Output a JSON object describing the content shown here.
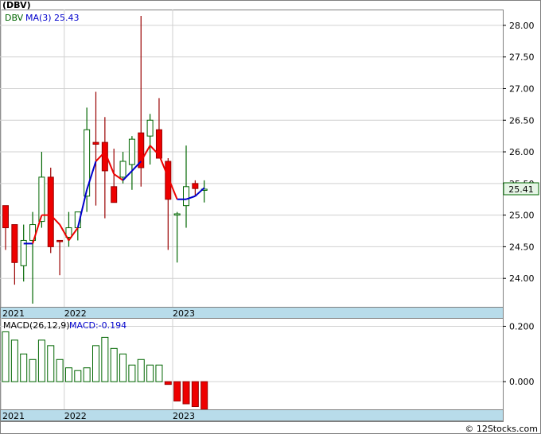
{
  "header": {
    "ticker_label": "(DBV)",
    "legend_symbol": "DBV",
    "legend_ma_label": "MA(3)",
    "legend_ma_value": "25.43",
    "last_price_tag": "25.41"
  },
  "macd_panel": {
    "label": "MACD(26,12,9)",
    "value_label": "MACD:-0.194",
    "ticks": [
      {
        "value": 0.2,
        "label": "0.200"
      },
      {
        "value": 0.0,
        "label": "0.000"
      }
    ],
    "ylim": [
      -0.1,
      0.23
    ]
  },
  "time_axis": {
    "year_labels": [
      {
        "label": "2021",
        "month_index": 0
      },
      {
        "label": "2022",
        "month_index": 7
      },
      {
        "label": "2023",
        "month_index": 19
      }
    ]
  },
  "footer": {
    "watermark": "© 12Stocks.com"
  },
  "colors": {
    "up_candle_fill": "#ffffff",
    "up_candle_stroke": "#006600",
    "down_candle_fill": "#ee0000",
    "wick_up": "#006600",
    "wick_down": "#990000",
    "ma_line_red": "#ee0000",
    "ma_line_blue": "#0000cc",
    "axis_band": "#b8dcea",
    "grid": "#d0d0d0",
    "macd_pos_stroke": "#006600",
    "macd_neg_fill": "#ee0000",
    "price_tag_bg": "#e6f5e6"
  },
  "chart_data": [
    {
      "type": "candlestick",
      "title": "(DBV)",
      "ylim": [
        23.55,
        28.25
      ],
      "yticks": [
        24.0,
        24.5,
        25.0,
        25.5,
        26.0,
        26.5,
        27.0,
        27.5,
        28.0
      ],
      "series": [
        {
          "name": "DBV",
          "values": [
            {
              "o": 25.15,
              "h": 25.15,
              "l": 24.45,
              "c": 24.8
            },
            {
              "o": 24.85,
              "h": 24.85,
              "l": 23.9,
              "c": 24.25
            },
            {
              "o": 24.2,
              "h": 24.85,
              "l": 23.95,
              "c": 24.6
            },
            {
              "o": 24.6,
              "h": 25.05,
              "l": 23.6,
              "c": 24.85
            },
            {
              "o": 24.9,
              "h": 26.0,
              "l": 24.8,
              "c": 25.6
            },
            {
              "o": 25.6,
              "h": 25.75,
              "l": 24.4,
              "c": 24.5
            },
            {
              "o": 24.6,
              "h": 24.6,
              "l": 24.05,
              "c": 24.58
            },
            {
              "o": 24.65,
              "h": 25.05,
              "l": 24.5,
              "c": 24.8
            },
            {
              "o": 24.8,
              "h": 25.05,
              "l": 24.6,
              "c": 25.05
            },
            {
              "o": 25.3,
              "h": 26.7,
              "l": 25.05,
              "c": 26.35
            },
            {
              "o": 26.15,
              "h": 26.95,
              "l": 25.15,
              "c": 26.12
            },
            {
              "o": 26.15,
              "h": 26.55,
              "l": 24.95,
              "c": 25.7
            },
            {
              "o": 25.45,
              "h": 26.05,
              "l": 25.4,
              "c": 25.2
            },
            {
              "o": 25.6,
              "h": 26.0,
              "l": 25.5,
              "c": 25.85
            },
            {
              "o": 25.8,
              "h": 26.25,
              "l": 25.4,
              "c": 26.2
            },
            {
              "o": 26.3,
              "h": 28.15,
              "l": 25.45,
              "c": 25.75
            },
            {
              "o": 26.25,
              "h": 26.6,
              "l": 25.8,
              "c": 26.5
            },
            {
              "o": 26.35,
              "h": 26.85,
              "l": 25.95,
              "c": 25.9
            },
            {
              "o": 25.85,
              "h": 25.9,
              "l": 24.45,
              "c": 25.25
            },
            {
              "o": 25.0,
              "h": 25.05,
              "l": 24.25,
              "c": 25.02
            },
            {
              "o": 25.15,
              "h": 26.1,
              "l": 24.8,
              "c": 25.45
            },
            {
              "o": 25.5,
              "h": 25.55,
              "l": 25.3,
              "c": 25.42
            },
            {
              "o": 25.41,
              "h": 25.55,
              "l": 25.2,
              "c": 25.41
            }
          ]
        },
        {
          "name": "MA(3)",
          "values": [
            null,
            null,
            24.55,
            24.55,
            25.0,
            25.0,
            24.85,
            24.6,
            24.8,
            25.4,
            25.85,
            26.0,
            25.65,
            25.55,
            25.7,
            25.85,
            26.1,
            25.95,
            25.6,
            25.25,
            25.25,
            25.3,
            25.43
          ]
        }
      ]
    },
    {
      "type": "bar",
      "title": "MACD(26,12,9)",
      "ylim": [
        -0.1,
        0.23
      ],
      "yticks": [
        0.2,
        0.0
      ],
      "series": [
        {
          "name": "MACD",
          "values": [
            0.18,
            0.15,
            0.1,
            0.08,
            0.15,
            0.13,
            0.08,
            0.05,
            0.04,
            0.05,
            0.13,
            0.16,
            0.12,
            0.1,
            0.06,
            0.08,
            0.06,
            0.06,
            -0.01,
            -0.07,
            -0.08,
            -0.09,
            -0.1
          ]
        }
      ]
    }
  ]
}
